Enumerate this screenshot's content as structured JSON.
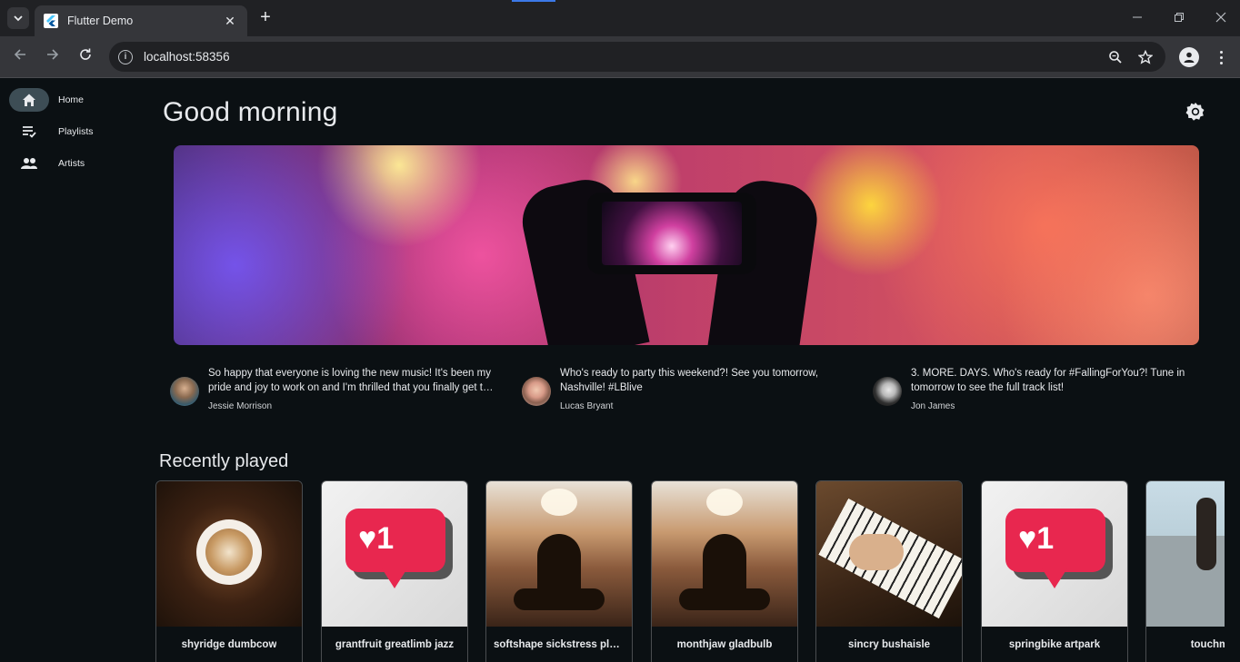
{
  "browser": {
    "tab_title": "Flutter Demo",
    "close_symbol": "✕",
    "new_tab_symbol": "+",
    "url": "localhost:58356"
  },
  "nav": {
    "items": [
      {
        "label": "Home",
        "icon": "home-icon",
        "active": true
      },
      {
        "label": "Playlists",
        "icon": "playlist-icon",
        "active": false
      },
      {
        "label": "Artists",
        "icon": "people-icon",
        "active": false
      }
    ]
  },
  "home": {
    "greeting": "Good morning",
    "posts": [
      {
        "text": "So happy that everyone is loving the new music! It's been my pride and joy to work on and I'm thrilled that you finally get to hear it!",
        "author": "Jessie Morrison"
      },
      {
        "text": "Who's ready to party this weekend?! See you tomorrow, Nashville! #LBlive",
        "author": "Lucas Bryant"
      },
      {
        "text": "3. MORE. DAYS. Who's ready for #FallingForYou?! Tune in tomorrow to see the full track list!",
        "author": "Jon James"
      }
    ],
    "recently_played_title": "Recently played",
    "recently_played": [
      {
        "title": "shyridge dumbcow",
        "art": "coffee"
      },
      {
        "title": "grantfruit greatlimb jazz",
        "art": "like"
      },
      {
        "title": "softshape sickstress plays",
        "art": "yoga"
      },
      {
        "title": "monthjaw gladbulb",
        "art": "yoga"
      },
      {
        "title": "sincry bushaisle",
        "art": "piano"
      },
      {
        "title": "springbike artpark",
        "art": "like"
      },
      {
        "title": "touchmoon",
        "art": "runner"
      }
    ],
    "like_badge_text": "♥1"
  },
  "colors": {
    "background": "#0b1013",
    "nav_active": "#3d4d55",
    "like_red": "#e8274f"
  }
}
